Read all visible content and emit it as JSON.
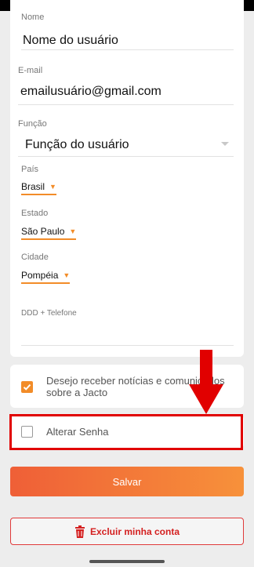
{
  "form": {
    "name_label": "Nome",
    "name_value": "Nome do usuário",
    "email_label": "E-mail",
    "email_value": "emailusuário@gmail.com",
    "role_label": "Função",
    "role_value": "Função do usuário",
    "country_label": "País",
    "country_value": "Brasil",
    "state_label": "Estado",
    "state_value": "São Paulo",
    "city_label": "Cidade",
    "city_value": "Pompéia",
    "phone_label": "DDD + Telefone",
    "phone_value": ""
  },
  "options": {
    "news_label": "Desejo receber notícias e comunicados sobre a Jacto",
    "news_checked": true,
    "password_label": "Alterar Senha",
    "password_checked": false
  },
  "buttons": {
    "save": "Salvar",
    "delete": "Excluir minha conta"
  },
  "colors": {
    "accent": "#f28c28",
    "annotation": "#e10000",
    "danger": "#d42020"
  },
  "icons": {
    "chevron": "chevron-down-icon",
    "trash": "trash-icon",
    "arrow": "arrow-down-icon"
  }
}
